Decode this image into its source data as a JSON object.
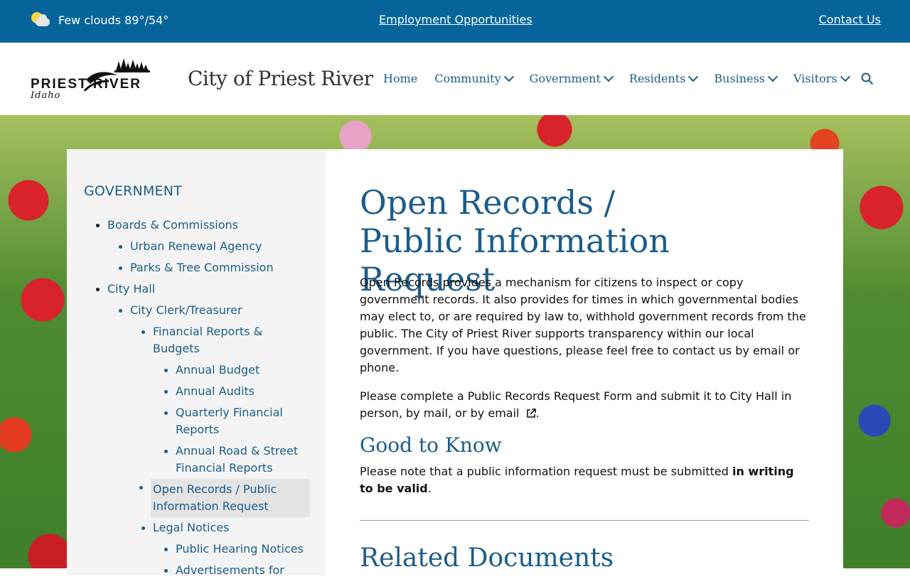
{
  "topbar": {
    "weather": "Few clouds 89°/54°",
    "employment_link": "Employment Opportunities",
    "contact_link": "Contact Us"
  },
  "header": {
    "logo_text_main": "PRIEST RIVER",
    "logo_text_sub": "Idaho",
    "site_title": "City of Priest River",
    "nav": [
      {
        "label": "Home"
      },
      {
        "label": "Community"
      },
      {
        "label": "Government"
      },
      {
        "label": "Residents"
      },
      {
        "label": "Business"
      },
      {
        "label": "Visitors"
      }
    ]
  },
  "sidebar": {
    "title": "GOVERNMENT",
    "items": [
      {
        "label": "Boards & Commissions"
      },
      {
        "label": "Urban Renewal Agency"
      },
      {
        "label": "Parks & Tree Commission"
      },
      {
        "label": "City Hall"
      },
      {
        "label": "City Clerk/Treasurer"
      },
      {
        "label": "Financial Reports & Budgets"
      },
      {
        "label": "Annual Budget"
      },
      {
        "label": "Annual Audits"
      },
      {
        "label": "Quarterly Financial Reports"
      },
      {
        "label": "Annual Road & Street Financial Reports"
      },
      {
        "label": "Open Records / Public Information Request"
      },
      {
        "label": "Legal Notices"
      },
      {
        "label": "Public Hearing Notices"
      },
      {
        "label": "Advertisements for"
      }
    ]
  },
  "main": {
    "title": "Open Records / Public Information Request",
    "para1": "Open Records provides a mechanism for citizens to inspect or copy government records. It also provides for times in which governmental bodies may elect to, or are required by law to, withhold government records from the public. The City of Priest River supports transparency within our local government. If you have questions, please feel free to contact us by email or phone.",
    "para2_text": "Please complete a Public Records Request Form and submit it to City Hall in person, by mail, or by email",
    "para2_end": ".",
    "good_to_know": "Good to Know",
    "para3_text": "Please note that a public information request must be submitted ",
    "para3_bold": "in writing to be valid",
    "para3_end": ".",
    "related": "Related Documents"
  },
  "colors": {
    "topbar_bg": "#05659b",
    "link_blue": "#1b5c8a",
    "sidebar_bg": "#f4f4f4"
  }
}
